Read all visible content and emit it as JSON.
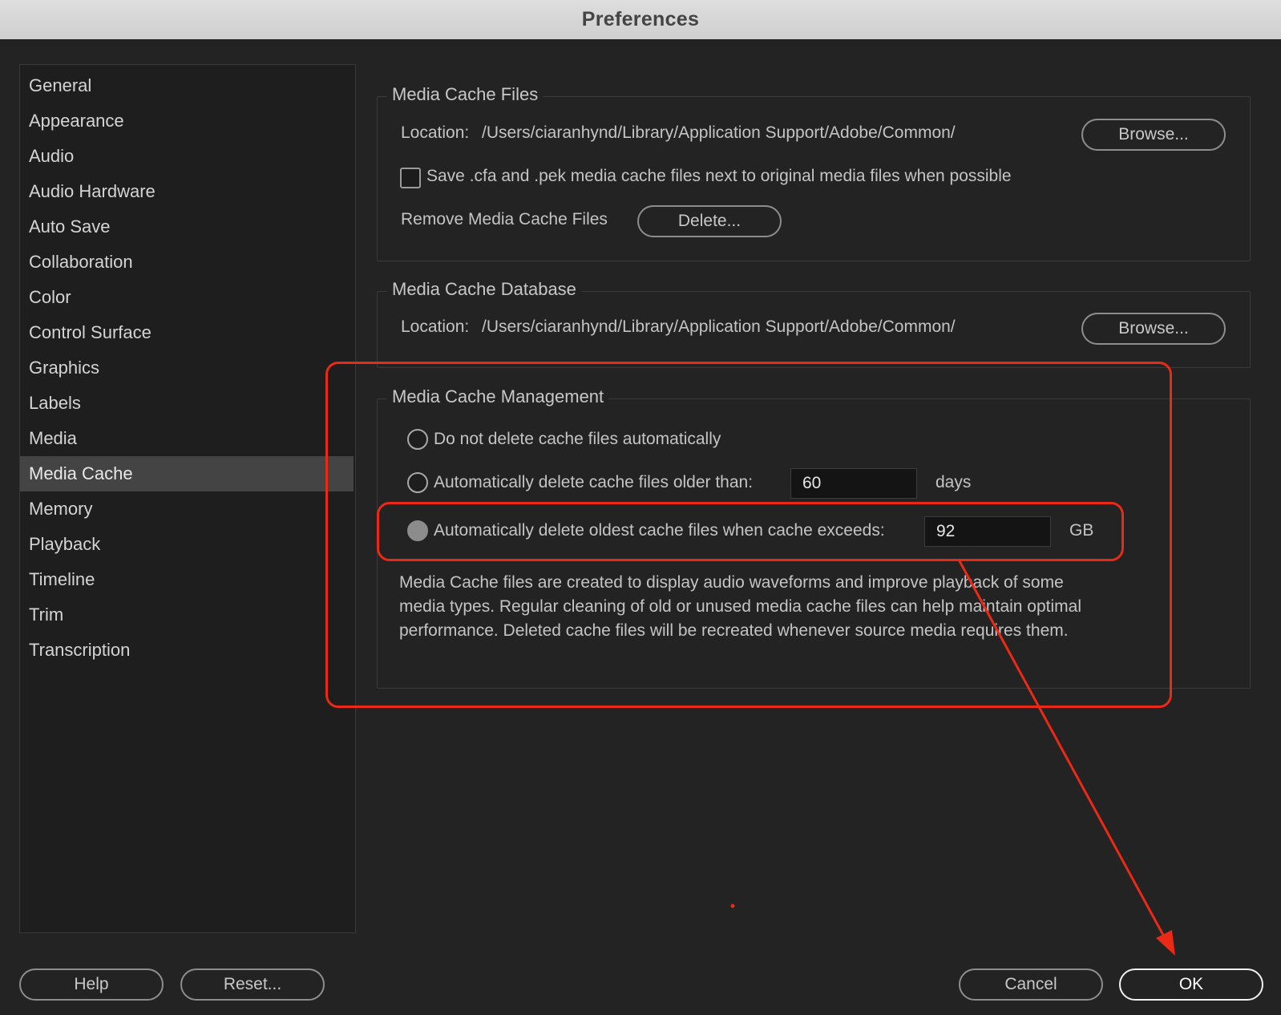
{
  "window": {
    "title": "Preferences"
  },
  "sidebar": {
    "items": [
      {
        "label": "General"
      },
      {
        "label": "Appearance"
      },
      {
        "label": "Audio"
      },
      {
        "label": "Audio Hardware"
      },
      {
        "label": "Auto Save"
      },
      {
        "label": "Collaboration"
      },
      {
        "label": "Color"
      },
      {
        "label": "Control Surface"
      },
      {
        "label": "Graphics"
      },
      {
        "label": "Labels"
      },
      {
        "label": "Media"
      },
      {
        "label": "Media Cache",
        "selected": true
      },
      {
        "label": "Memory"
      },
      {
        "label": "Playback"
      },
      {
        "label": "Timeline"
      },
      {
        "label": "Trim"
      },
      {
        "label": "Transcription"
      }
    ]
  },
  "media_cache_files": {
    "title": "Media Cache Files",
    "location_label": "Location:",
    "location_path": "/Users/ciaranhynd/Library/Application Support/Adobe/Common/",
    "browse_label": "Browse...",
    "save_next_label": "Save .cfa and .pek media cache files next to original media files when possible",
    "save_next_checked": false,
    "remove_label": "Remove Media Cache Files",
    "delete_label": "Delete..."
  },
  "media_cache_database": {
    "title": "Media Cache Database",
    "location_label": "Location:",
    "location_path": "/Users/ciaranhynd/Library/Application Support/Adobe/Common/",
    "browse_label": "Browse..."
  },
  "media_cache_management": {
    "title": "Media Cache Management",
    "option_no_delete": "Do not delete cache files automatically",
    "option_older_than": "Automatically delete cache files older than:",
    "older_than_value": "60",
    "older_than_unit": "days",
    "option_exceeds": "Automatically delete oldest cache files when cache exceeds:",
    "exceeds_value": "92",
    "exceeds_unit": "GB",
    "selected_option": "exceeds",
    "description": "Media Cache files are created to display audio waveforms and improve playback of some media types.  Regular cleaning of old or unused media cache files can help maintain optimal performance. Deleted cache files will be recreated whenever source media requires them."
  },
  "footer": {
    "help_label": "Help",
    "reset_label": "Reset...",
    "cancel_label": "Cancel",
    "ok_label": "OK"
  },
  "colors": {
    "background": "#232323",
    "annotation": "#ea2a16"
  }
}
